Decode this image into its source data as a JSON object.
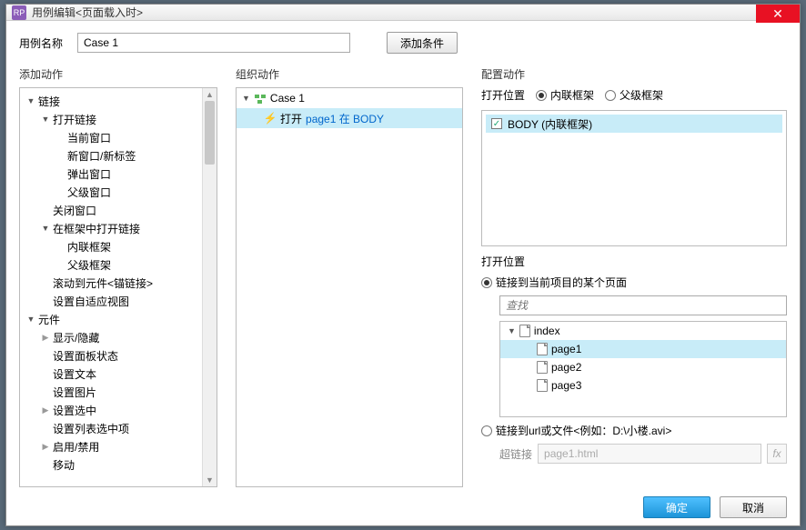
{
  "window": {
    "title": "用例编辑<页面载入时>",
    "app_badge": "RP",
    "close": "✕"
  },
  "nameRow": {
    "label": "用例名称",
    "value": "Case 1",
    "addCondition": "添加条件"
  },
  "left": {
    "title": "添加动作",
    "items": [
      {
        "label": "链接",
        "depth": 0,
        "arrow": "exp"
      },
      {
        "label": "打开链接",
        "depth": 1,
        "arrow": "exp"
      },
      {
        "label": "当前窗口",
        "depth": 2,
        "arrow": "none"
      },
      {
        "label": "新窗口/新标签",
        "depth": 2,
        "arrow": "none"
      },
      {
        "label": "弹出窗口",
        "depth": 2,
        "arrow": "none"
      },
      {
        "label": "父级窗口",
        "depth": 2,
        "arrow": "none"
      },
      {
        "label": "关闭窗口",
        "depth": 1,
        "arrow": "none"
      },
      {
        "label": "在框架中打开链接",
        "depth": 1,
        "arrow": "exp"
      },
      {
        "label": "内联框架",
        "depth": 2,
        "arrow": "none"
      },
      {
        "label": "父级框架",
        "depth": 2,
        "arrow": "none"
      },
      {
        "label": "滚动到元件<锚链接>",
        "depth": 1,
        "arrow": "none"
      },
      {
        "label": "设置自适应视图",
        "depth": 1,
        "arrow": "none"
      },
      {
        "label": "元件",
        "depth": 0,
        "arrow": "exp"
      },
      {
        "label": "显示/隐藏",
        "depth": 1,
        "arrow": "col"
      },
      {
        "label": "设置面板状态",
        "depth": 1,
        "arrow": "none"
      },
      {
        "label": "设置文本",
        "depth": 1,
        "arrow": "none"
      },
      {
        "label": "设置图片",
        "depth": 1,
        "arrow": "none"
      },
      {
        "label": "设置选中",
        "depth": 1,
        "arrow": "col"
      },
      {
        "label": "设置列表选中项",
        "depth": 1,
        "arrow": "none"
      },
      {
        "label": "启用/禁用",
        "depth": 1,
        "arrow": "col"
      },
      {
        "label": "移动",
        "depth": 1,
        "arrow": "none"
      }
    ]
  },
  "mid": {
    "title": "组织动作",
    "caseLabel": "Case 1",
    "action_prefix": "打开",
    "action_link": "page1 在 BODY"
  },
  "right": {
    "title": "配置动作",
    "openPosLabel": "打开位置",
    "radioInline": "内联框架",
    "radioParent": "父级框架",
    "frameItem": "BODY (内联框架)",
    "openPosLabel2": "打开位置",
    "radioProjectPage": "链接到当前项目的某个页面",
    "searchPlaceholder": "查找",
    "pages": {
      "root": "index",
      "p1": "page1",
      "p2": "page2",
      "p3": "page3"
    },
    "radioUrl": "链接到url或文件<例如：D:\\小楼.avi>",
    "hyperlinkLabel": "超链接",
    "hyperlinkValue": "page1.html",
    "fx": "fx"
  },
  "footer": {
    "ok": "确定",
    "cancel": "取消"
  }
}
